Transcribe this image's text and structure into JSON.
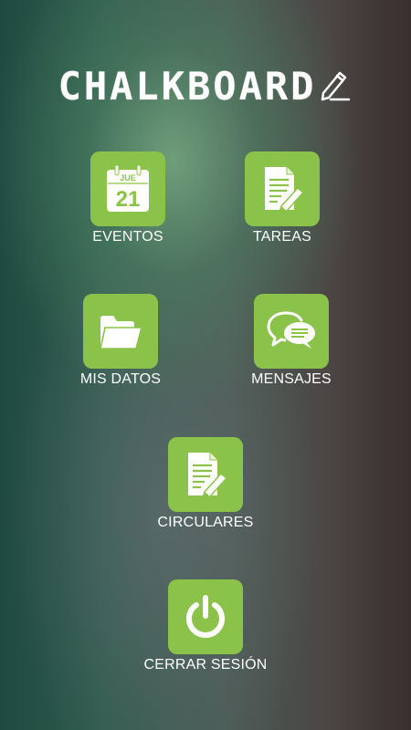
{
  "app": {
    "title": "CHALKBOARD"
  },
  "colors": {
    "tile_green": "#8bc34a",
    "label_white": "#ffffff"
  },
  "menu": [
    {
      "label": "EVENTOS",
      "icon": "calendar-icon",
      "calendar_month": "JUE",
      "calendar_day": "21"
    },
    {
      "label": "TAREAS",
      "icon": "document-edit-icon"
    },
    {
      "label": "MIS DATOS",
      "icon": "folder-icon"
    },
    {
      "label": "MENSAJES",
      "icon": "chat-bubbles-icon"
    },
    {
      "label": "CIRCULARES",
      "icon": "document-edit-icon"
    },
    {
      "label": "CERRAR SESIÓN",
      "icon": "power-icon"
    }
  ]
}
